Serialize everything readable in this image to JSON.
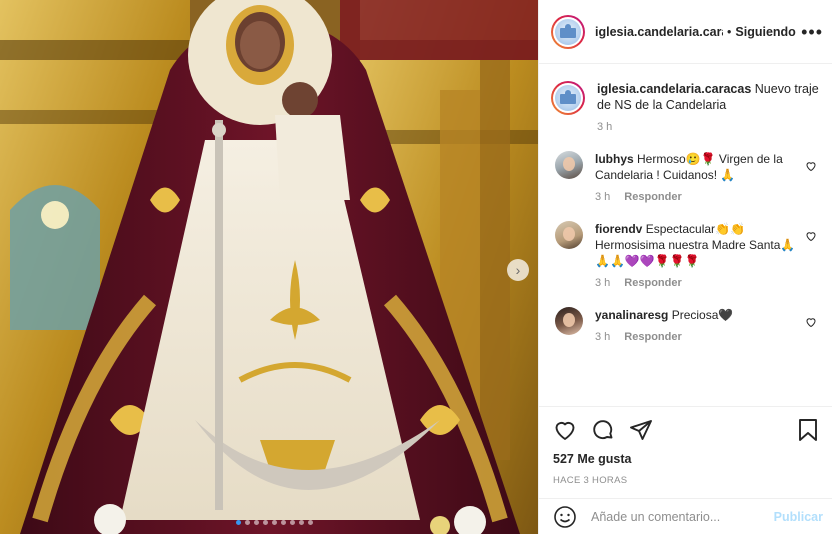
{
  "post": {
    "username": "iglesia.candelaria.caracas",
    "follow_status": "Siguiendo",
    "separator": "•",
    "caption": "Nuevo traje de NS de la Candelaria",
    "caption_time": "3 h",
    "likes": "527 Me gusta",
    "posted_ago": "HACE 3 HORAS",
    "carousel_count": 9,
    "carousel_active_index": 0
  },
  "comments": [
    {
      "username": "lubhys",
      "text": "Hermoso🥲🌹 Virgen de la Candelaria ! Cuidanos! 🙏",
      "time": "3 h",
      "reply": "Responder"
    },
    {
      "username": "fiorendv",
      "text": "Espectacular👏👏 Hermosisima nuestra Madre Santa🙏🙏🙏💜💜🌹🌹🌹",
      "time": "3 h",
      "reply": "Responder"
    },
    {
      "username": "yanalinaresg",
      "text": "Preciosa🖤",
      "time": "3 h",
      "reply": "Responder"
    }
  ],
  "composer": {
    "placeholder": "Añade un comentario...",
    "publish": "Publicar"
  },
  "icons": {
    "more": "more-options-icon",
    "like": "heart-icon",
    "comment": "comment-icon",
    "share": "share-icon",
    "save": "bookmark-icon",
    "emoji": "emoji-icon",
    "next": "chevron-right-icon"
  },
  "colors": {
    "link_blue": "#3897f0",
    "publish_disabled": "#b2dffc",
    "muted": "#8e8e8e",
    "text": "#262626",
    "story_ring_start": "#f09433",
    "story_ring_end": "#bc1888"
  }
}
